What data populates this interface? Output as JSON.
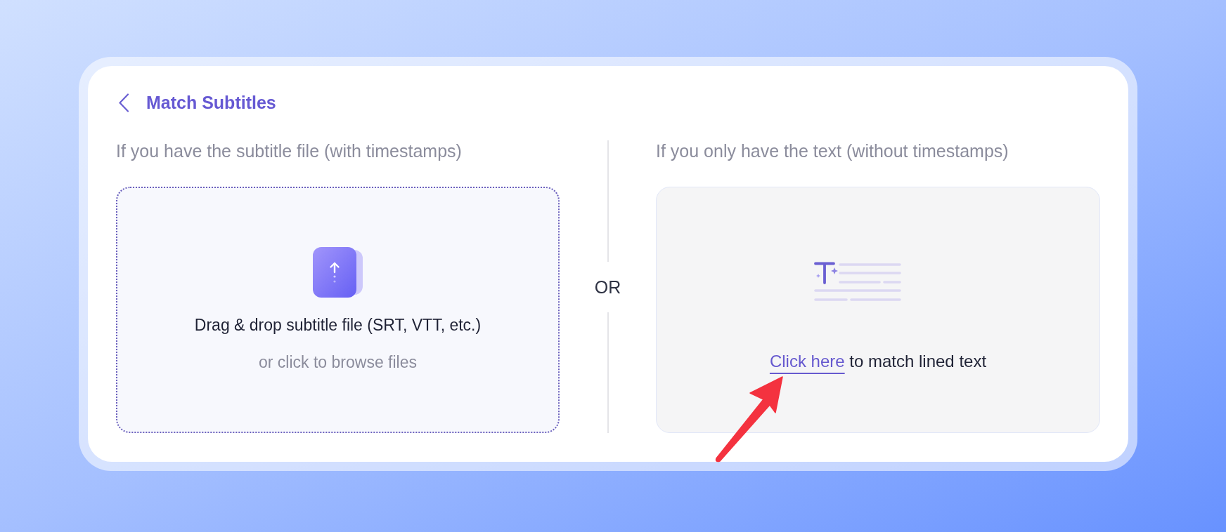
{
  "header": {
    "title": "Match Subtitles"
  },
  "upload_option": {
    "heading": "If you have the subtitle file (with timestamps)",
    "prompt": "Drag & drop subtitle file (SRT, VTT, etc.)",
    "hint": "or click to browse files"
  },
  "separator": {
    "label": "OR"
  },
  "text_option": {
    "heading": "If you only have the text (without timestamps)",
    "link": "Click here",
    "prompt": "to match lined text"
  }
}
